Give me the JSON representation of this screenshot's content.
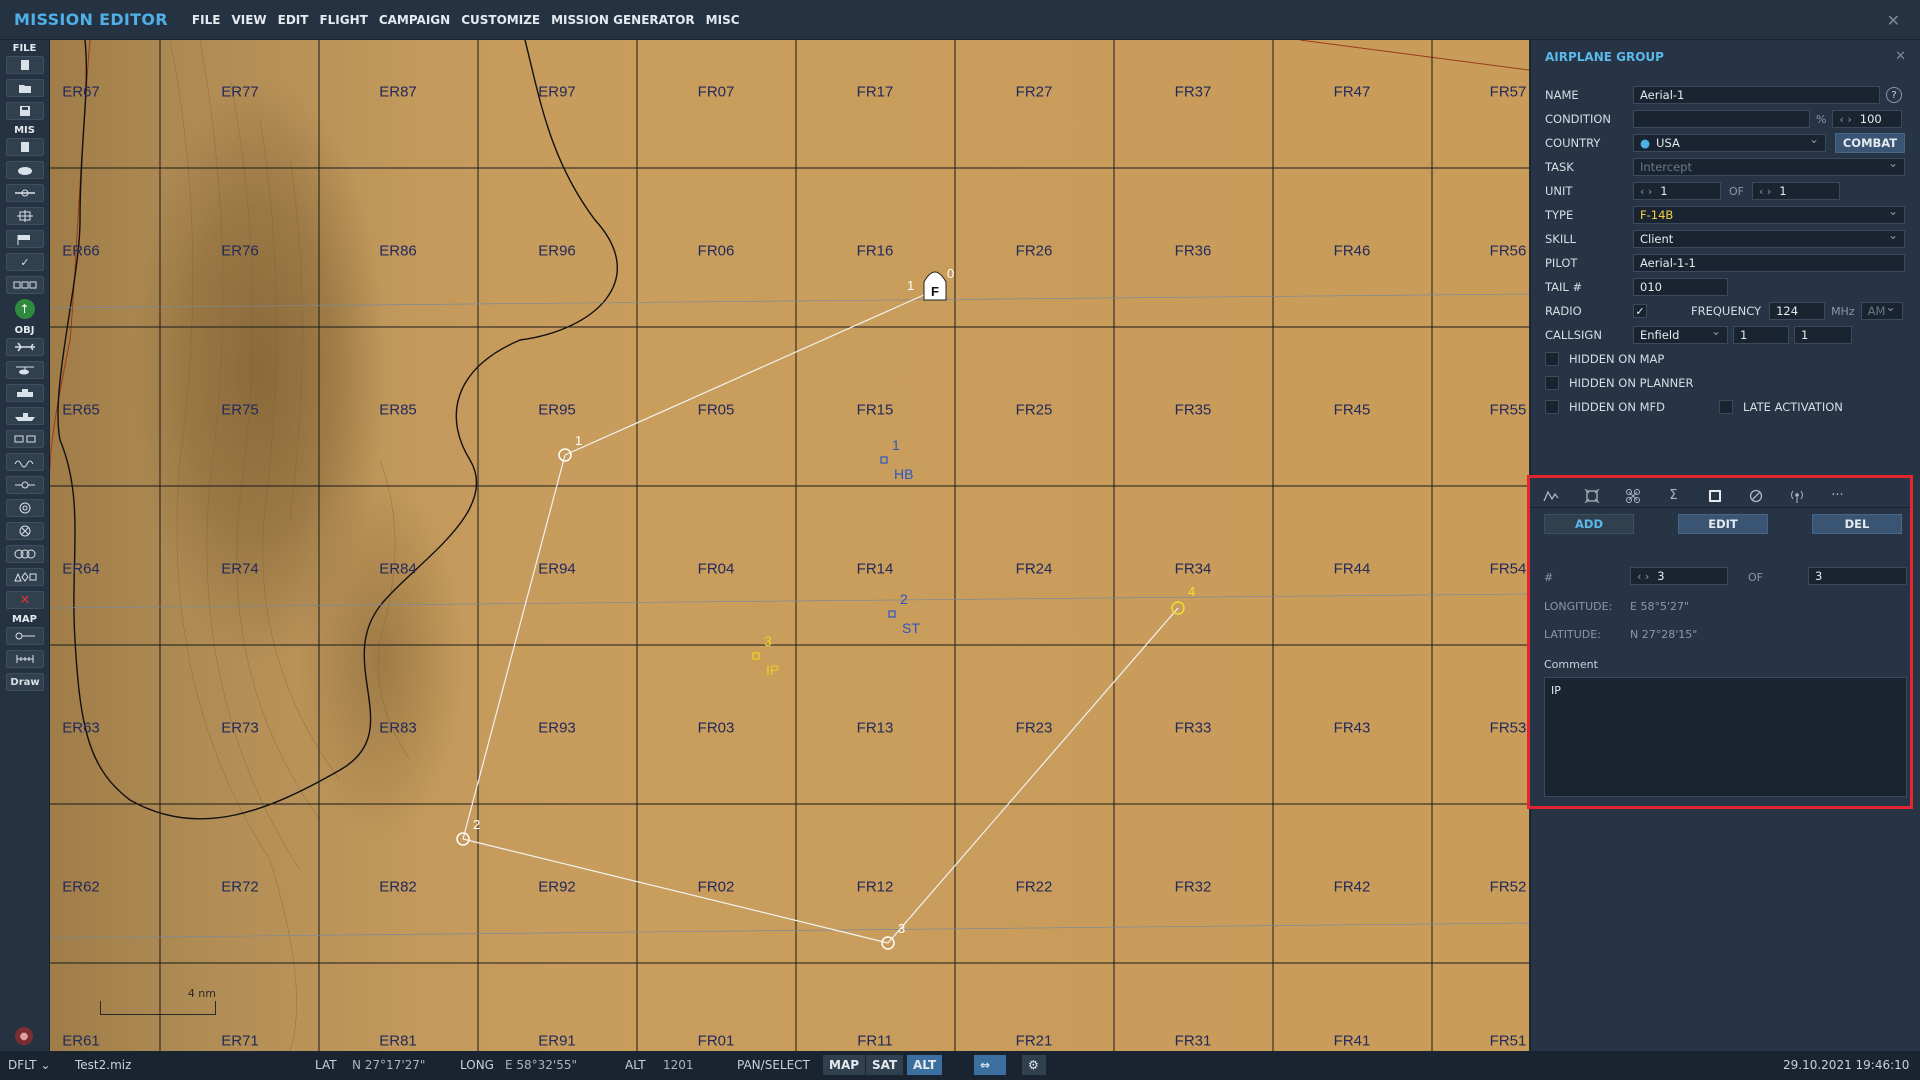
{
  "app_title": "MISSION EDITOR",
  "menu": [
    "FILE",
    "VIEW",
    "EDIT",
    "FLIGHT",
    "CAMPAIGN",
    "CUSTOMIZE",
    "MISSION GENERATOR",
    "MISC"
  ],
  "window_close": "✕",
  "toolbar": {
    "file_label": "FILE",
    "mis_label": "MIS",
    "obj_label": "OBJ",
    "map_label": "MAP",
    "draw_label": "Draw"
  },
  "map": {
    "grid_labels": [
      [
        "ER67",
        "ER77",
        "ER87",
        "ER97",
        "FR07",
        "FR17",
        "FR27",
        "FR37",
        "FR47",
        "FR57"
      ],
      [
        "ER66",
        "ER76",
        "ER86",
        "ER96",
        "FR06",
        "FR16",
        "FR26",
        "FR36",
        "FR46",
        "FR56"
      ],
      [
        "ER65",
        "ER75",
        "ER85",
        "ER95",
        "FR05",
        "FR15",
        "FR25",
        "FR35",
        "FR45",
        "FR55"
      ],
      [
        "ER64",
        "ER74",
        "ER84",
        "ER94",
        "FR04",
        "FR14",
        "FR24",
        "FR34",
        "FR44",
        "FR54"
      ],
      [
        "ER63",
        "ER73",
        "ER83",
        "ER93",
        "FR03",
        "FR13",
        "FR23",
        "FR33",
        "FR43",
        "FR53"
      ],
      [
        "ER62",
        "ER72",
        "ER82",
        "ER92",
        "FR02",
        "FR12",
        "FR22",
        "FR32",
        "FR42",
        "FR52"
      ],
      [
        "ER61",
        "ER71",
        "ER81",
        "ER91",
        "FR01",
        "FR11",
        "FR21",
        "FR31",
        "FR41",
        "FR51"
      ]
    ],
    "route_waypoints": [
      "0",
      "1",
      "2",
      "3",
      "4"
    ],
    "start_marker": "F",
    "nav_points": [
      {
        "num": "1",
        "name": "HB"
      },
      {
        "num": "2",
        "name": "ST"
      },
      {
        "num": "3",
        "name": "IP"
      }
    ],
    "scale_label": "4 nm"
  },
  "panel": {
    "title": "AIRPLANE GROUP",
    "close": "✕",
    "name_label": "NAME",
    "name_value": "Aerial-1",
    "help": "?",
    "condition_label": "CONDITION",
    "condition_unit": "%",
    "condition_value": "100",
    "country_label": "COUNTRY",
    "country_value": "USA",
    "combat_button": "COMBAT",
    "task_label": "TASK",
    "task_value": "Intercept",
    "unit_label": "UNIT",
    "unit_value": "1",
    "unit_of": "OF",
    "unit_total": "1",
    "type_label": "TYPE",
    "type_value": "F-14B",
    "skill_label": "SKILL",
    "skill_value": "Client",
    "pilot_label": "PILOT",
    "pilot_value": "Aerial-1-1",
    "tail_label": "TAIL #",
    "tail_value": "010",
    "radio_label": "RADIO",
    "radio_checked": "✓",
    "frequency_label": "FREQUENCY",
    "frequency_value": "124",
    "frequency_unit": "MHz",
    "modulation": "AM",
    "callsign_label": "CALLSIGN",
    "callsign_name": "Enfield",
    "callsign_num1": "1",
    "callsign_num2": "1",
    "hidden_map": "HIDDEN ON MAP",
    "hidden_planner": "HIDDEN ON PLANNER",
    "hidden_mfd": "HIDDEN ON MFD",
    "late_activation": "LATE ACTIVATION"
  },
  "waypoint_panel": {
    "add_button": "ADD",
    "edit_button": "EDIT",
    "del_button": "DEL",
    "number_label": "#",
    "number_value": "3",
    "of_label": "OF",
    "of_value": "3",
    "longitude_label": "LONGITUDE:",
    "longitude_value": "E 58°5'27\"",
    "latitude_label": "LATITUDE:",
    "latitude_value": "N 27°28'15\"",
    "comment_label": "Comment",
    "comment_value": "IP"
  },
  "status": {
    "profile": "DFLT",
    "filename": "Test2.miz",
    "lat_label": "LAT",
    "lat_value": "N 27°17'27\"",
    "long_label": "LONG",
    "long_value": "E 58°32'55\"",
    "alt_label": "ALT",
    "alt_value": "1201",
    "mode": "PAN/SELECT",
    "map_btn": "MAP",
    "sat_btn": "SAT",
    "alt_btn": "ALT",
    "datetime": "29.10.2021 19:46:10"
  },
  "colors": {
    "accent": "#4fb0e8",
    "highlight_border": "#e3262e",
    "map_sand": "#c99c5a",
    "nav_point_blue": "#2a56c8",
    "nav_point_yellow": "#f0d020"
  }
}
